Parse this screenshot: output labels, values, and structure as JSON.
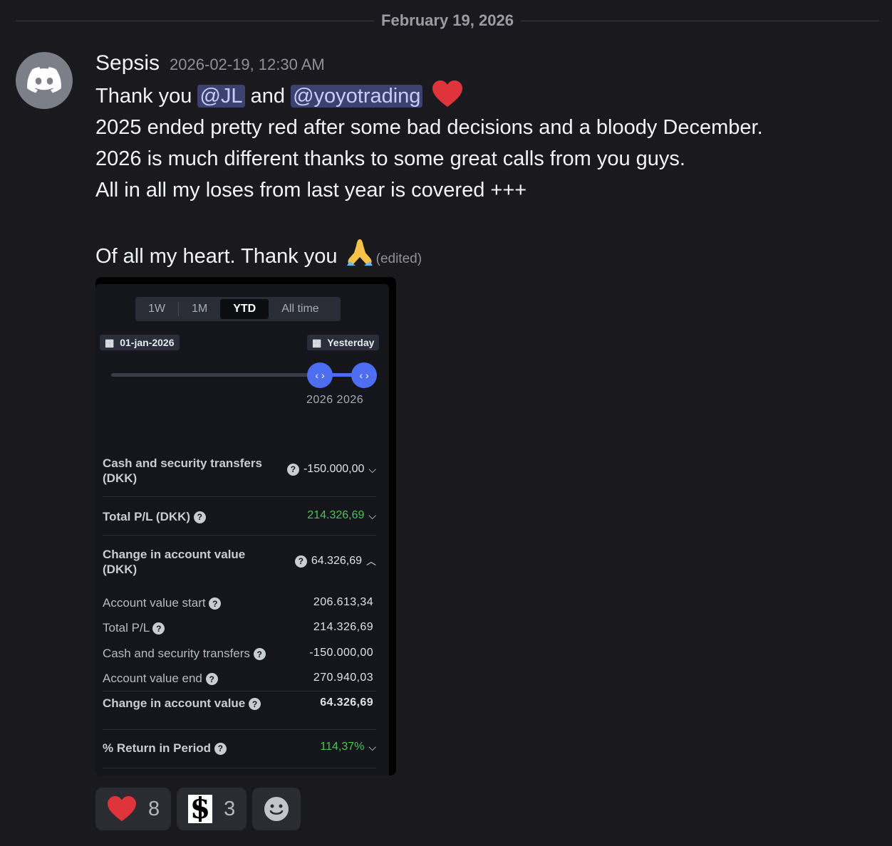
{
  "divider": {
    "date": "February 19, 2026"
  },
  "message": {
    "username": "Sepsis",
    "timestamp": "2026-02-19, 12:30 AM",
    "line1_prefix": "Thank you ",
    "mention1": "@JL",
    "line1_mid": " and ",
    "mention2": "@yoyotrading",
    "line2": "2025 ended pretty red after some bad decisions and a bloody December.",
    "line3": "2026 is much different thanks to some great calls from you guys.",
    "line4": "All in all my loses from last year is covered +++",
    "line5": "Of all my heart. Thank you ",
    "edited": "(edited)"
  },
  "embed": {
    "periods": [
      "1W",
      "1M",
      "YTD",
      "All time"
    ],
    "selected_period": "YTD",
    "start_date": "01-jan-2026",
    "end_date": "Yesterday",
    "slider_years": "2026 2026",
    "rows": {
      "cash_label": "Cash and security transfers (DKK)",
      "cash_value": "-150.000,00",
      "pl_label": "Total P/L (DKK)",
      "pl_value": "214.326,69",
      "change_label": "Change in account value (DKK)",
      "change_value": "64.326,69"
    },
    "details": [
      {
        "label": "Account value start",
        "value": "206.613,34"
      },
      {
        "label": "Total P/L",
        "value": "214.326,69"
      },
      {
        "label": "Cash and security transfers",
        "value": "-150.000,00"
      },
      {
        "label": "Account value end",
        "value": "270.940,03"
      },
      {
        "label": "Change in account value",
        "value": "64.326,69"
      }
    ],
    "return_label": "% Return in Period",
    "return_value": "114,37%"
  },
  "reactions": [
    {
      "icon": "heart-emoji",
      "count": "8"
    },
    {
      "icon": "s-logo-emoji",
      "count": "3"
    }
  ],
  "colors": {
    "mention_bg": "#3c4270",
    "accent_blue": "#4e6ef2",
    "positive_green": "#4cc35a"
  }
}
